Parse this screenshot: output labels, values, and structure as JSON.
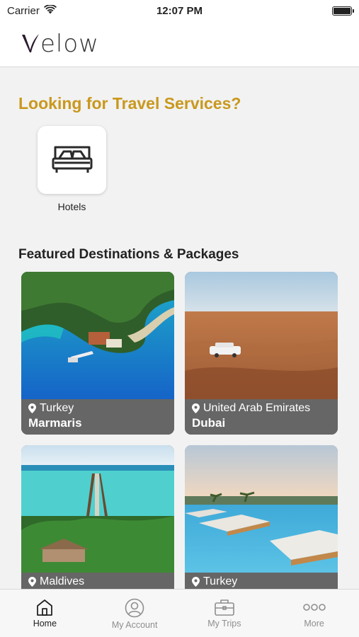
{
  "status_bar": {
    "carrier": "Carrier",
    "time": "12:07 PM"
  },
  "header": {
    "logo_text": "elow"
  },
  "services": {
    "title": "Looking for Travel Services?",
    "items": [
      {
        "label": "Hotels",
        "icon": "bed-icon"
      }
    ]
  },
  "featured": {
    "title": "Featured Destinations & Packages",
    "items": [
      {
        "country": "Turkey",
        "city": "Marmaris"
      },
      {
        "country": "United Arab Emirates",
        "city": "Dubai"
      },
      {
        "country": "Maldives",
        "city": ""
      },
      {
        "country": "Turkey",
        "city": ""
      }
    ]
  },
  "tabbar": {
    "items": [
      {
        "label": "Home",
        "icon": "home-icon",
        "active": true
      },
      {
        "label": "My Account",
        "icon": "account-icon",
        "active": false
      },
      {
        "label": "My Trips",
        "icon": "briefcase-icon",
        "active": false
      },
      {
        "label": "More",
        "icon": "more-icon",
        "active": false
      }
    ]
  },
  "colors": {
    "accent_gold": "#c9981d",
    "caption_bg": "#666666",
    "active_tab": "#222222",
    "inactive_tab": "#8e8e8e"
  }
}
